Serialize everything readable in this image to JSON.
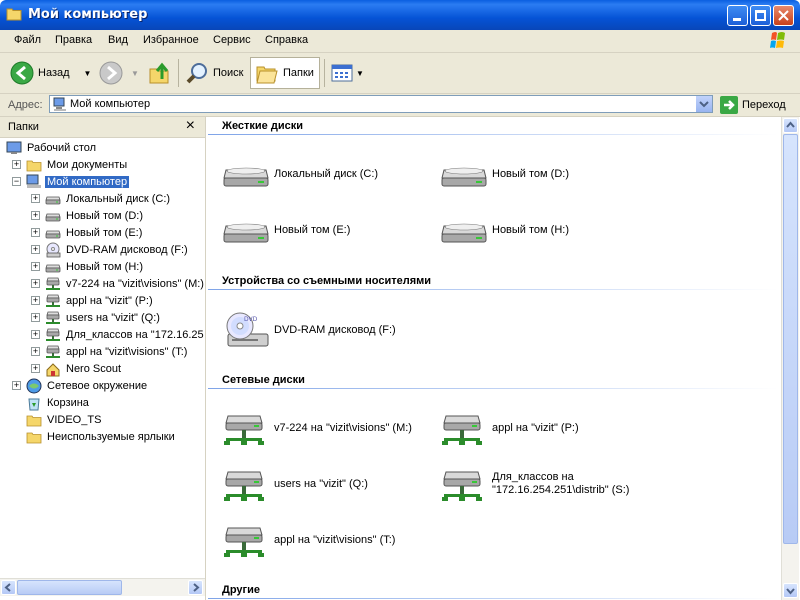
{
  "window": {
    "title": "Мой компьютер"
  },
  "menu": [
    "Файл",
    "Правка",
    "Вид",
    "Избранное",
    "Сервис",
    "Справка"
  ],
  "toolbar": {
    "back": "Назад",
    "search": "Поиск",
    "folders": "Папки"
  },
  "address": {
    "label": "Адрес:",
    "value": "Мой компьютер",
    "go": "Переход"
  },
  "folders_pane": {
    "title": "Папки",
    "close": "×",
    "tree": [
      "Рабочий стол",
      "Мои документы",
      "Мой компьютер",
      "Локальный диск (C:)",
      "Новый том (D:)",
      "Новый том (E:)",
      "DVD-RAM дисковод (F:)",
      "Новый том (H:)",
      "v7-224 на \"vizit\\visions\" (M:)",
      "appl на \"vizit\" (P:)",
      "users на \"vizit\" (Q:)",
      "Для_классов на \"172.16.25",
      "appl на \"vizit\\visions\" (T:)",
      "Nero Scout",
      "Сетевое окружение",
      "Корзина",
      "VIDEO_TS",
      "Неиспользуемые ярлыки"
    ]
  },
  "groups": {
    "hard": {
      "title": "Жесткие диски",
      "items": [
        "Локальный диск (C:)",
        "Новый том (D:)",
        "Новый том (E:)",
        "Новый том (H:)"
      ]
    },
    "removable": {
      "title": "Устройства со съемными носителями",
      "items": [
        "DVD-RAM дисковод (F:)"
      ]
    },
    "network": {
      "title": "Сетевые диски",
      "items": [
        "v7-224 на \"vizit\\visions\" (M:)",
        "appl на \"vizit\" (P:)",
        "users на \"vizit\" (Q:)",
        "Для_классов на",
        "\"172.16.254.251\\distrib\" (S:)",
        "appl на \"vizit\\visions\" (T:)"
      ]
    },
    "other": {
      "title": "Другие"
    }
  },
  "colors": {
    "title_bar": "#0553d6",
    "chrome": "#ece9d8",
    "selection": "#316ac5",
    "group_line": "#7fa4e8"
  }
}
